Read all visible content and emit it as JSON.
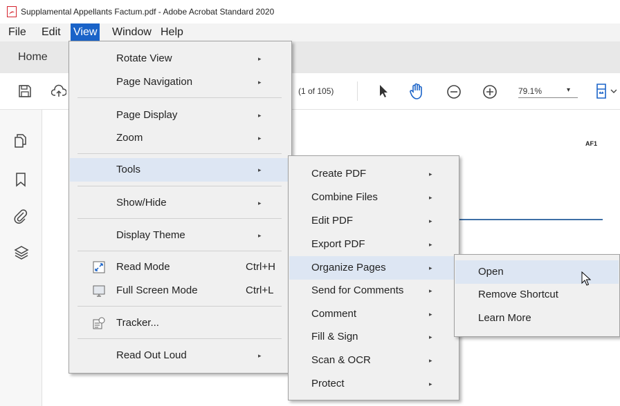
{
  "window": {
    "title": "Supplamental Appellants Factum.pdf - Adobe Acrobat Standard 2020"
  },
  "menubar": {
    "items": [
      "File",
      "Edit",
      "View",
      "Window",
      "Help"
    ]
  },
  "tabs": {
    "home": "Home"
  },
  "toolbar": {
    "page_count": "(1 of 105)",
    "zoom": "79.1%",
    "zoom_arrow": "▾"
  },
  "document": {
    "header": "AF1"
  },
  "view_menu": {
    "rotate": "Rotate View",
    "page_nav": "Page Navigation",
    "page_display": "Page Display",
    "zoom": "Zoom",
    "tools": "Tools",
    "show_hide": "Show/Hide",
    "display_theme": "Display Theme",
    "read_mode": "Read Mode",
    "read_mode_sc": "Ctrl+H",
    "full_screen": "Full Screen Mode",
    "full_screen_sc": "Ctrl+L",
    "tracker": "Tracker...",
    "read_out_loud": "Read Out Loud"
  },
  "tools_menu": {
    "items": [
      "Create PDF",
      "Combine Files",
      "Edit PDF",
      "Export PDF",
      "Organize Pages",
      "Send for Comments",
      "Comment",
      "Fill & Sign",
      "Scan & OCR",
      "Protect"
    ]
  },
  "organize_menu": {
    "open": "Open",
    "remove": "Remove Shortcut",
    "learn": "Learn More"
  },
  "colors": {
    "accent": "#1a63c8",
    "highlight": "#dde6f3",
    "doc_rule": "#3d6fa6"
  },
  "arrow": "▸"
}
